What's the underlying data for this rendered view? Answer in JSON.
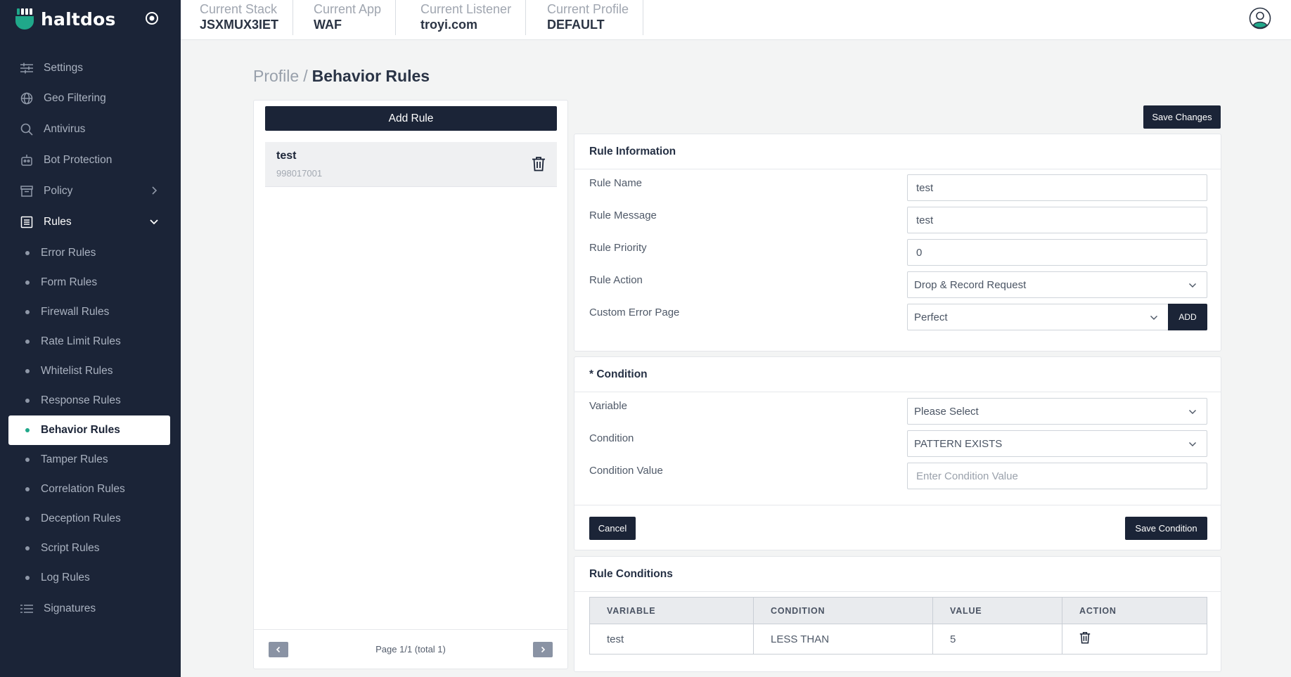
{
  "brand": {
    "name": "haltdos"
  },
  "sidebar": {
    "items": [
      {
        "label": "Settings",
        "icon": "sliders-icon"
      },
      {
        "label": "Geo Filtering",
        "icon": "globe-icon"
      },
      {
        "label": "Antivirus",
        "icon": "search-icon"
      },
      {
        "label": "Bot Protection",
        "icon": "robot-icon"
      },
      {
        "label": "Policy",
        "icon": "archive-icon"
      },
      {
        "label": "Rules",
        "icon": "list-box-icon"
      },
      {
        "label": "Signatures",
        "icon": "list-icon"
      }
    ],
    "rules_sub": [
      "Error Rules",
      "Form Rules",
      "Firewall Rules",
      "Rate Limit Rules",
      "Whitelist Rules",
      "Response Rules",
      "Behavior Rules",
      "Tamper Rules",
      "Correlation Rules",
      "Deception Rules",
      "Script Rules",
      "Log Rules"
    ],
    "active_sub": "Behavior Rules"
  },
  "context": {
    "stack": {
      "label": "Current Stack",
      "value": "JSXMUX3IET"
    },
    "app": {
      "label": "Current App",
      "value": "WAF"
    },
    "listener": {
      "label": "Current Listener",
      "value": "troyi.com"
    },
    "profile": {
      "label": "Current Profile",
      "value": "DEFAULT"
    }
  },
  "breadcrumb": {
    "parent": "Profile",
    "separator": "/",
    "current": "Behavior Rules"
  },
  "rule_list": {
    "add_label": "Add Rule",
    "rules": [
      {
        "name": "test",
        "id": "998017001"
      }
    ],
    "pager": {
      "text": "Page 1/1 (total 1)",
      "prev": "‹",
      "next": "›"
    }
  },
  "save_changes_label": "Save Changes",
  "rule_info": {
    "title": "Rule Information",
    "name": {
      "label": "Rule Name",
      "value": "test"
    },
    "message": {
      "label": "Rule Message",
      "value": "test"
    },
    "priority": {
      "label": "Rule Priority",
      "value": "0"
    },
    "action": {
      "label": "Rule Action",
      "value": "Drop & Record Request"
    },
    "error_page": {
      "label": "Custom Error Page",
      "value": "Perfect",
      "add_label": "ADD"
    }
  },
  "condition": {
    "title": "* Condition",
    "variable": {
      "label": "Variable",
      "value": "Please Select"
    },
    "condition": {
      "label": "Condition",
      "value": "PATTERN EXISTS"
    },
    "value": {
      "label": "Condition Value",
      "placeholder": "Enter Condition Value"
    },
    "cancel_label": "Cancel",
    "save_label": "Save Condition"
  },
  "rule_conditions": {
    "title": "Rule Conditions",
    "columns": [
      "VARIABLE",
      "CONDITION",
      "VALUE",
      "ACTION"
    ],
    "rows": [
      {
        "variable": "test",
        "condition": "LESS THAN",
        "value": "5"
      }
    ]
  },
  "colors": {
    "sidebar_bg": "#1b2437",
    "accent": "#20a88a",
    "page_bg": "#f3f4f4"
  }
}
